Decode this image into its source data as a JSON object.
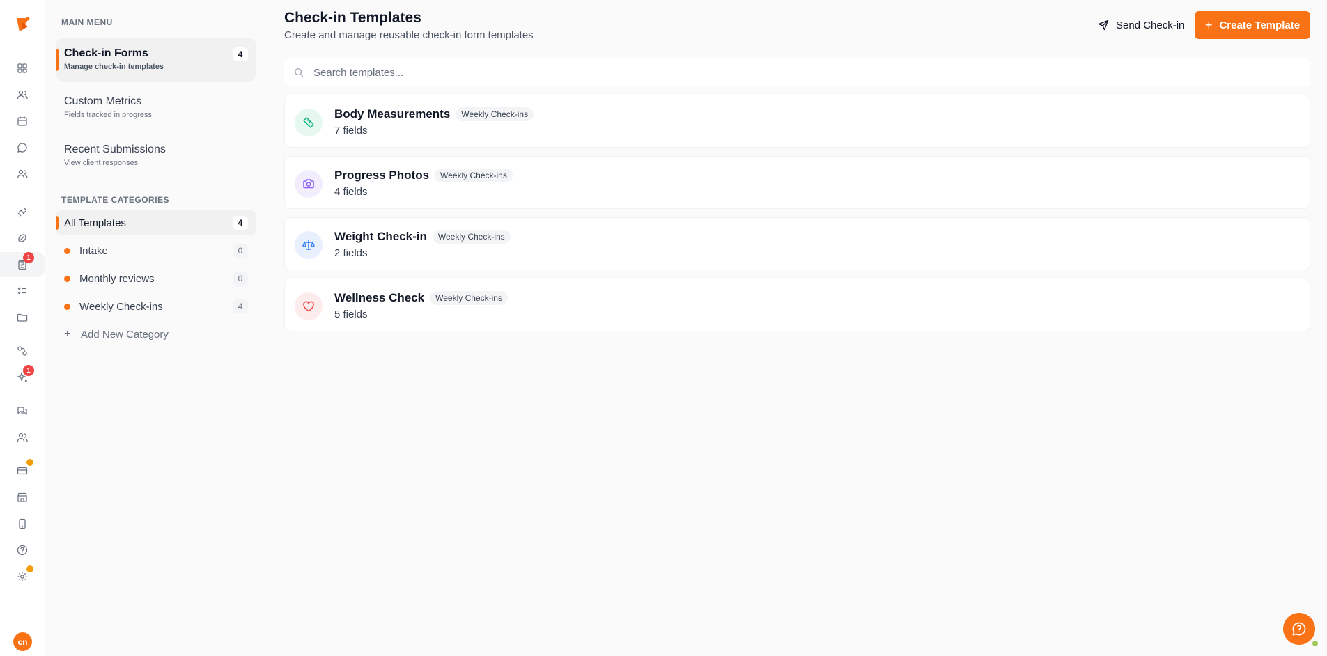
{
  "rail": {
    "badges": [
      "1",
      "1"
    ],
    "avatar_initials": "cn",
    "icons": [
      "dashboard-icon",
      "clients-icon",
      "calendar-icon",
      "chat-icon",
      "team-icon",
      "workout-icon",
      "nutrition-icon",
      "checkin-icon",
      "tasks-icon",
      "folder-icon",
      "automation-icon",
      "ai-icon",
      "messages-icon",
      "groups-icon",
      "billing-icon",
      "store-icon",
      "mobile-icon",
      "help-icon",
      "settings-icon"
    ]
  },
  "sidebar": {
    "main_menu_label": "MAIN MENU",
    "menu": [
      {
        "title": "Check-in Forms",
        "subtitle": "Manage check-in templates",
        "count": "4"
      },
      {
        "title": "Custom Metrics",
        "subtitle": "Fields tracked in progress"
      },
      {
        "title": "Recent Submissions",
        "subtitle": "View client responses"
      }
    ],
    "categories_label": "TEMPLATE CATEGORIES",
    "categories": [
      {
        "label": "All Templates",
        "count": "4"
      },
      {
        "label": "Intake",
        "count": "0"
      },
      {
        "label": "Monthly reviews",
        "count": "0"
      },
      {
        "label": "Weekly Check-ins",
        "count": "4"
      }
    ],
    "add_category": "Add New Category"
  },
  "header": {
    "title": "Check-in Templates",
    "subtitle": "Create and manage reusable check-in form templates",
    "send_label": "Send Check-in",
    "create_label": "Create Template"
  },
  "search": {
    "placeholder": "Search templates..."
  },
  "templates": [
    {
      "name": "Body Measurements",
      "tag": "Weekly Check-ins",
      "fields": "7 fields",
      "icon": "ruler-icon",
      "color": "#10b981",
      "bg": "#e7f8f0"
    },
    {
      "name": "Progress Photos",
      "tag": "Weekly Check-ins",
      "fields": "4 fields",
      "icon": "camera-icon",
      "color": "#8b5cf6",
      "bg": "#f1edfd"
    },
    {
      "name": "Weight Check-in",
      "tag": "Weekly Check-ins",
      "fields": "2 fields",
      "icon": "scale-icon",
      "color": "#3b82f6",
      "bg": "#e8f0fe"
    },
    {
      "name": "Wellness Check",
      "tag": "Weekly Check-ins",
      "fields": "5 fields",
      "icon": "heart-icon",
      "color": "#ef4444",
      "bg": "#fdecec"
    }
  ],
  "colors": {
    "accent": "#f97316",
    "badge": "#ef4444",
    "dot": "#f59e0b"
  }
}
